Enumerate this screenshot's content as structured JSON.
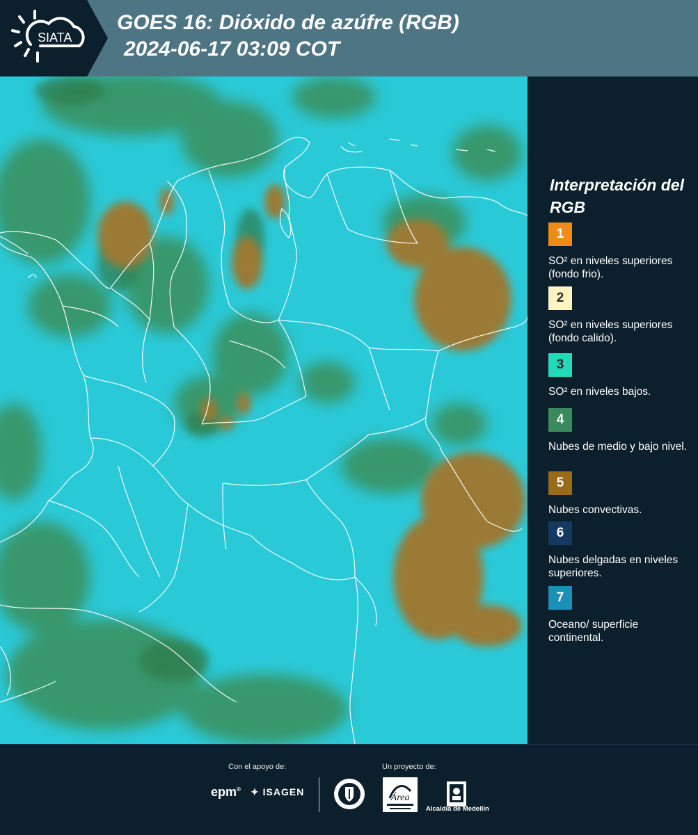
{
  "header": {
    "logo_text": "SIATA",
    "title_line1": "GOES 16: Dióxido de azúfre (RGB)",
    "title_line2": "2024-06-17 03:09 COT"
  },
  "map": {
    "background_color": "#2ac9d8",
    "cloud_low_color": "#3b8f5a",
    "convective_color": "#9a7a35",
    "border_color": "#ffffff"
  },
  "legend": {
    "title": "Interpretación del RGB",
    "items": [
      {
        "number": "1",
        "color": "#f08a18",
        "description": "SO² en niveles superiores (fondo frio)."
      },
      {
        "number": "2",
        "color": "#fdf4c2",
        "description": "SO² en niveles superiores (fondo calido)."
      },
      {
        "number": "3",
        "color": "#22d9b8",
        "description": "SO² en niveles bajos."
      },
      {
        "number": "4",
        "color": "#3a8a5e",
        "description": "Nubes de medio y bajo nivel."
      },
      {
        "number": "5",
        "color": "#9a6a16",
        "description": "Nubes convectivas."
      },
      {
        "number": "6",
        "color": "#143a63",
        "description": "Nubes delgadas en niveles superiores."
      },
      {
        "number": "7",
        "color": "#1a8fb8",
        "description": "Oceano/ superficie continental."
      }
    ]
  },
  "footer": {
    "support_label": "Con el apoyo de:",
    "project_label": "Un proyecto de:",
    "epm": "epm",
    "isagen": "ISAGEN",
    "alcaldia": "Alcaldía de Medellín"
  }
}
